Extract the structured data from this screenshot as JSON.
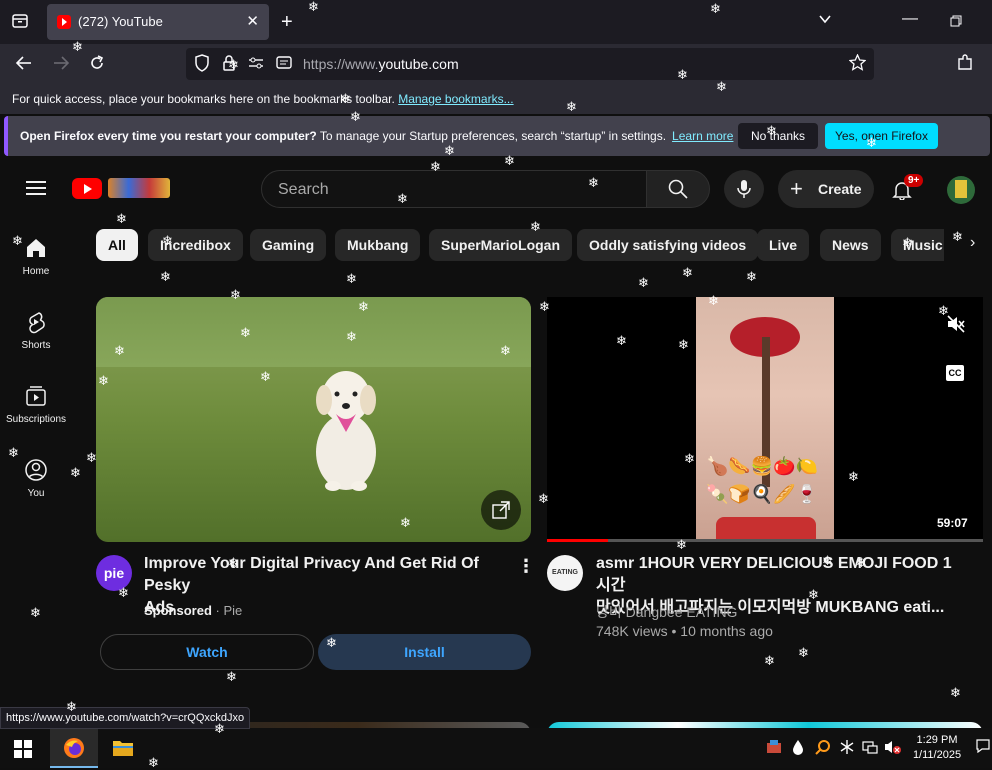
{
  "browser": {
    "tab_title": "(272) YouTube",
    "url_prefix": "https://www.",
    "url_domain": "youtube.com",
    "bookmarks_message": "For quick access, place your bookmarks here on the bookmarks toolbar.",
    "bookmarks_link": "Manage bookmarks...",
    "notification": {
      "bold_text": "Open Firefox every time you restart your computer?",
      "text": "To manage your Startup preferences, search “startup” in settings.",
      "link": "Learn more",
      "no_thanks": "No thanks",
      "open_button": "Yes, open Firefox"
    },
    "status_url": "https://www.youtube.com/watch?v=crQQxckdJxo"
  },
  "youtube": {
    "search_placeholder": "Search",
    "create_label": "Create",
    "notification_count": "9+",
    "sidebar": [
      {
        "label": "Home",
        "icon": "home-icon"
      },
      {
        "label": "Shorts",
        "icon": "shorts-icon"
      },
      {
        "label": "Subscriptions",
        "icon": "subscriptions-icon"
      },
      {
        "label": "You",
        "icon": "you-icon"
      }
    ],
    "chips": [
      "All",
      "Incredibox",
      "Gaming",
      "Mukbang",
      "SuperMarioLogan",
      "Oddly satisfying videos",
      "Live",
      "News",
      "Music"
    ],
    "videos": [
      {
        "title_line1": "Improve Your Digital Privacy And Get Rid Of Pesky",
        "title_line2": "Ads",
        "sponsored": "Sponsored",
        "channel": "Pie",
        "channel_avatar_text": "pie",
        "watch_label": "Watch",
        "install_label": "Install"
      },
      {
        "title_line1": "asmr 1HOUR VERY DELICIOUS EMOJI FOOD 1시간",
        "title_line2": "맛있어서 배고파지는 이모지먹방 MUKBANG eati...",
        "channel": "당비 Dangbee EATING",
        "channel_avatar_text": "EATING",
        "views": "748K views",
        "age": "10 months ago",
        "duration": "59:07",
        "cc_label": "CC",
        "progress": 0.14,
        "emoji": "🍗🌭🍔🍅🍋🍡🍞🍳🥖🍷"
      }
    ]
  },
  "taskbar": {
    "time": "1:29 PM",
    "date": "1/11/2025"
  },
  "colors": {
    "youtube_bg": "#0f0f0f",
    "youtube_red": "#ff0000",
    "firefox_accent": "#00ddff",
    "link": "#3ea6ff"
  }
}
